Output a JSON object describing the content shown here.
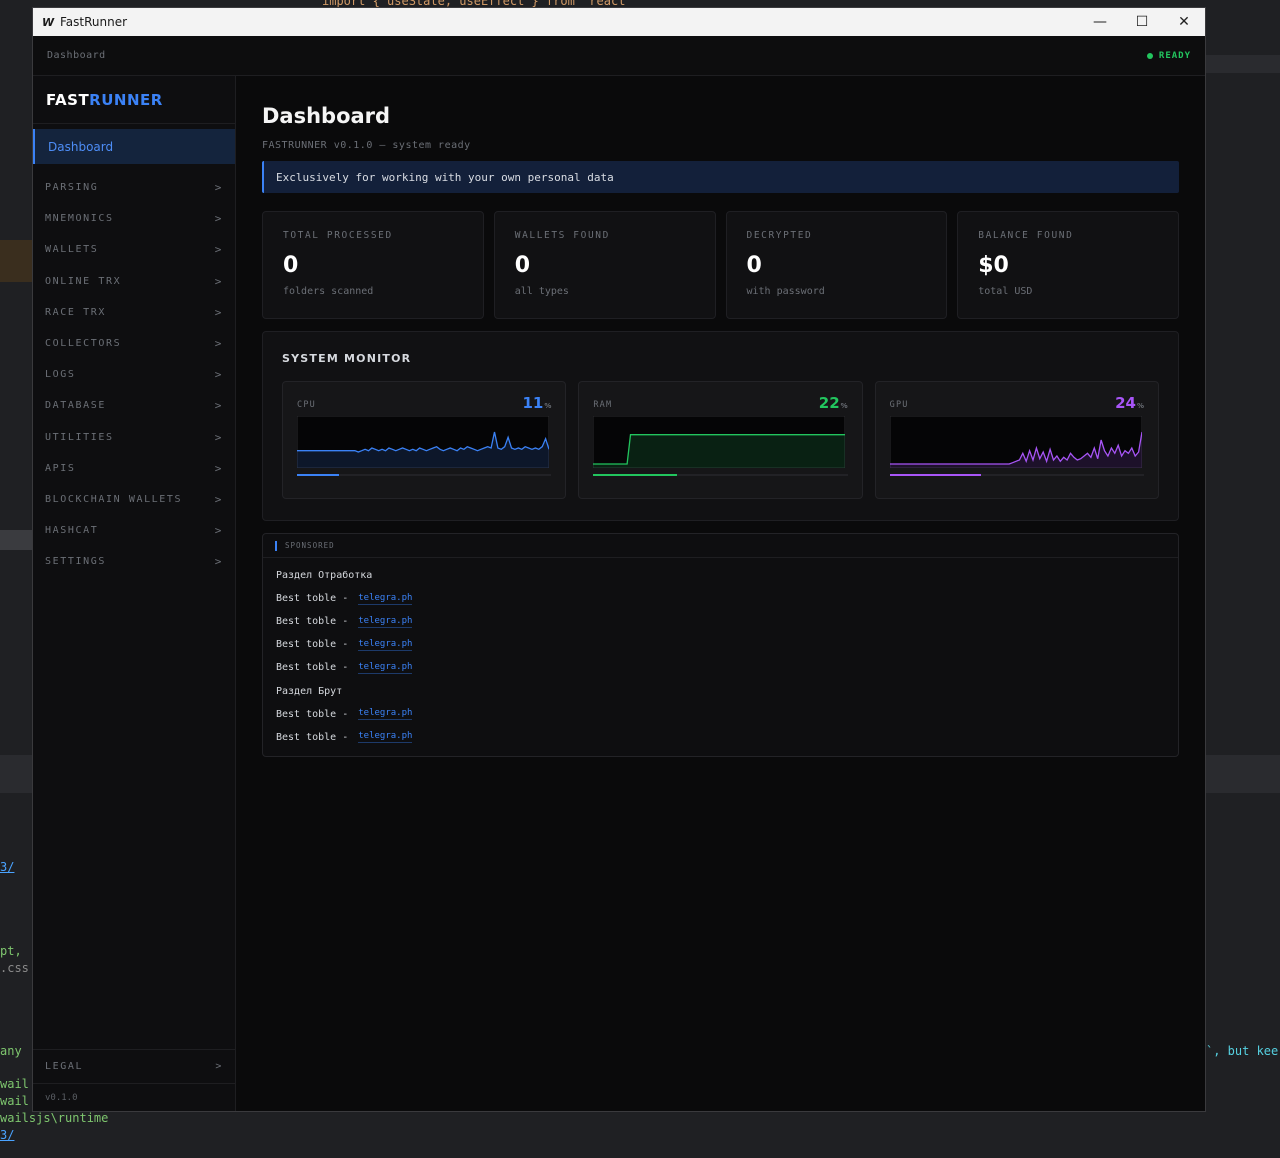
{
  "background": {
    "code_top": "import { useState, useEffect } from 'react'",
    "frag_1": "3/",
    "frag_2": "pt, ",
    "frag_3": ".css",
    "frag_4": "any",
    "frag_5": "`, but kee",
    "frag_6": "wail",
    "frag_7": "wail",
    "frag_8": "wailsjs\\runtime",
    "frag_9": "3/"
  },
  "window": {
    "app_icon": "W",
    "title": "FastRunner",
    "minimize": "—",
    "maximize": "☐",
    "close": "✕"
  },
  "topbar": {
    "breadcrumb": "Dashboard",
    "status": "READY"
  },
  "sidebar": {
    "logo_a": "FAST",
    "logo_b": "RUNNER",
    "active_item": "Dashboard",
    "items": [
      {
        "label": "PARSING"
      },
      {
        "label": "MNEMONICS"
      },
      {
        "label": "WALLETS"
      },
      {
        "label": "ONLINE TRX"
      },
      {
        "label": "RACE TRX"
      },
      {
        "label": "COLLECTORS"
      },
      {
        "label": "LOGS"
      },
      {
        "label": "DATABASE"
      },
      {
        "label": "UTILITIES"
      },
      {
        "label": "APIS"
      },
      {
        "label": "BLOCKCHAIN WALLETS"
      },
      {
        "label": "HASHCAT"
      },
      {
        "label": "SETTINGS"
      }
    ],
    "chevron": ">",
    "legal": "LEGAL",
    "version": "v0.1.0"
  },
  "main": {
    "title": "Dashboard",
    "subtitle": "FASTRUNNER v0.1.0 — system ready",
    "notice": "Exclusively for working with your own personal data",
    "stats": [
      {
        "label": "TOTAL PROCESSED",
        "value": "0",
        "sub": "folders scanned"
      },
      {
        "label": "WALLETS FOUND",
        "value": "0",
        "sub": "all types"
      },
      {
        "label": "DECRYPTED",
        "value": "0",
        "sub": "with password"
      },
      {
        "label": "BALANCE FOUND",
        "value": "$0",
        "sub": "total USD"
      }
    ],
    "monitor": {
      "title": "SYSTEM MONITOR",
      "gauges": [
        {
          "label": "CPU",
          "value": "11",
          "unit": "%",
          "percent": 11,
          "color": "#3b82f6",
          "history": [
            10,
            10,
            10,
            10,
            10,
            10,
            10,
            10,
            10,
            10,
            10,
            10,
            10,
            10,
            10,
            10,
            10,
            10,
            9,
            10,
            11,
            10,
            12,
            11,
            10,
            11,
            10,
            12,
            11,
            10,
            11,
            12,
            11,
            10,
            11,
            10,
            12,
            11,
            10,
            11,
            12,
            13,
            11,
            10,
            11,
            12,
            11,
            10,
            12,
            11,
            13,
            12,
            11,
            10,
            11,
            12,
            13,
            12,
            24,
            12,
            11,
            13,
            20,
            12,
            11,
            12,
            11,
            13,
            12,
            11,
            12,
            11,
            13,
            19,
            11
          ]
        },
        {
          "label": "RAM",
          "value": "22",
          "unit": "%",
          "percent": 22,
          "color": "#22c55e",
          "history": [
            0,
            0,
            0,
            0,
            0,
            0,
            0,
            0,
            0,
            0,
            0,
            22,
            22,
            22,
            22,
            22,
            22,
            22,
            22,
            22,
            22,
            22,
            22,
            22,
            22,
            22,
            22,
            22,
            22,
            22,
            22,
            22,
            22,
            22,
            22,
            22,
            22,
            22,
            22,
            22,
            22,
            22,
            22,
            22,
            22,
            22,
            22,
            22,
            22,
            22,
            22,
            22,
            22,
            22,
            22,
            22,
            22,
            22,
            22,
            22,
            22,
            22,
            22,
            22,
            22,
            22,
            22,
            22,
            22,
            22,
            22,
            22,
            22,
            22,
            22
          ]
        },
        {
          "label": "GPU",
          "value": "24",
          "unit": "%",
          "percent": 24,
          "color": "#a855f7",
          "history": [
            0,
            0,
            0,
            0,
            0,
            0,
            0,
            0,
            0,
            0,
            0,
            0,
            0,
            0,
            0,
            0,
            0,
            0,
            0,
            0,
            0,
            0,
            0,
            0,
            0,
            0,
            0,
            0,
            0,
            0,
            0,
            0,
            0,
            0,
            0,
            0,
            1,
            2,
            3,
            8,
            2,
            10,
            3,
            12,
            4,
            9,
            2,
            11,
            3,
            6,
            2,
            5,
            3,
            8,
            5,
            3,
            4,
            6,
            8,
            5,
            12,
            4,
            18,
            10,
            6,
            12,
            8,
            14,
            6,
            10,
            8,
            12,
            6,
            9,
            24
          ]
        }
      ]
    },
    "sponsored": {
      "title": "SPONSORED",
      "rows": [
        {
          "text": "Раздел Отработка",
          "link": ""
        },
        {
          "text": "Best toble -",
          "link": "telegra.ph"
        },
        {
          "text": "Best toble -",
          "link": "telegra.ph"
        },
        {
          "text": "Best toble -",
          "link": "telegra.ph"
        },
        {
          "text": "Best toble -",
          "link": "telegra.ph"
        },
        {
          "text": "Раздел Брут",
          "link": ""
        },
        {
          "text": "Best toble -",
          "link": "telegra.ph"
        },
        {
          "text": "Best toble -",
          "link": "telegra.ph"
        }
      ]
    }
  }
}
